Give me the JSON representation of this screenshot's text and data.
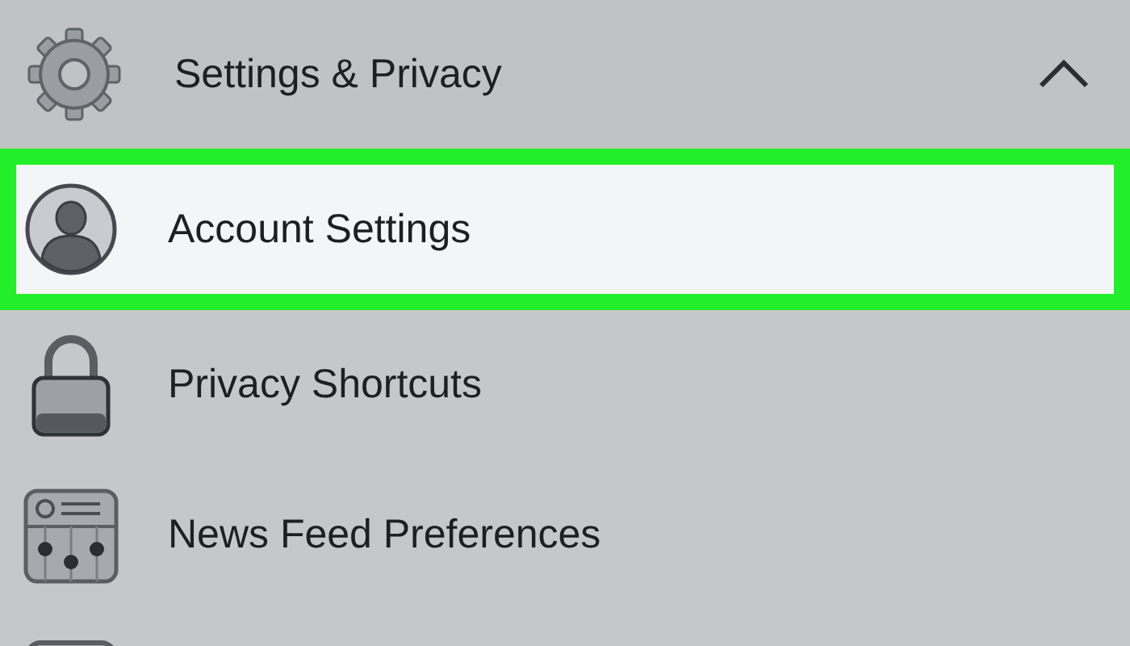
{
  "section": {
    "title": "Settings & Privacy",
    "expanded": true
  },
  "items": [
    {
      "kind": "account",
      "label": "Account Settings",
      "selected": true
    },
    {
      "kind": "lock",
      "label": "Privacy Shortcuts",
      "selected": false
    },
    {
      "kind": "feed",
      "label": "News Feed Preferences",
      "selected": false
    },
    {
      "kind": "card",
      "selected": false
    }
  ]
}
